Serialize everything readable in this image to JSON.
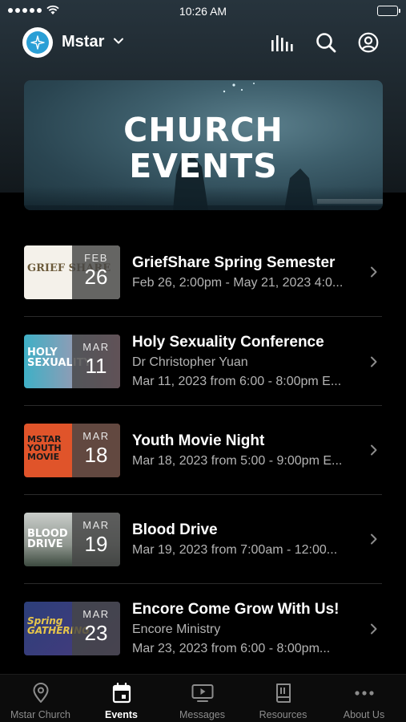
{
  "status_bar": {
    "time": "10:26 AM"
  },
  "header": {
    "org_name": "Mstar",
    "icons": [
      "logo-icon",
      "chevron-down-icon",
      "audio-bars-icon",
      "search-icon",
      "profile-icon"
    ]
  },
  "banner": {
    "title_line1": "CHURCH",
    "title_line2": "EVENTS"
  },
  "events": [
    {
      "month": "FEB",
      "day": "26",
      "title": "GriefShare Spring Semester",
      "line1": "Feb 26, 2:00pm - May 21, 2023 4:0...",
      "line2": "",
      "thumb_text": "GRIEF SHARE",
      "thumb_bg": "#f4f1ea"
    },
    {
      "month": "MAR",
      "day": "11",
      "title": "Holy Sexuality Conference",
      "line1": "Dr Christopher Yuan",
      "line2": "Mar 11, 2023 from 6:00 - 8:00pm E...",
      "thumb_text": "HOLY SEXUALITY",
      "thumb_bg": "#3fb0c6"
    },
    {
      "month": "MAR",
      "day": "18",
      "title": "Youth Movie Night",
      "line1": "Mar 18, 2023 from 5:00 - 9:00pm E...",
      "line2": "",
      "thumb_text": "MSTAR YOUTH MOVIE",
      "thumb_bg": "#e0542a"
    },
    {
      "month": "MAR",
      "day": "19",
      "title": "Blood Drive",
      "line1": "Mar 19, 2023 from 7:00am - 12:00...",
      "line2": "",
      "thumb_text": "BLOOD DRIVE",
      "thumb_bg": "#9aa19c"
    },
    {
      "month": "MAR",
      "day": "23",
      "title": "Encore Come Grow With Us!",
      "line1": "Encore Ministry",
      "line2": "Mar 23, 2023 from 6:00 - 8:00pm...",
      "thumb_text": "Spring GATHERING",
      "thumb_bg": "#2c3f7a"
    }
  ],
  "tabs": [
    {
      "label": "Mstar Church",
      "icon": "location-pin-icon",
      "active": false
    },
    {
      "label": "Events",
      "icon": "calendar-icon",
      "active": true
    },
    {
      "label": "Messages",
      "icon": "play-screen-icon",
      "active": false
    },
    {
      "label": "Resources",
      "icon": "book-icon",
      "active": false
    },
    {
      "label": "About Us",
      "icon": "more-dots-icon",
      "active": false
    }
  ],
  "colors": {
    "background": "#000000",
    "header": "#1f2a31",
    "accent": "#ffffff",
    "muted_text": "#b4b4b4",
    "tab_inactive": "#8c8c8c"
  }
}
